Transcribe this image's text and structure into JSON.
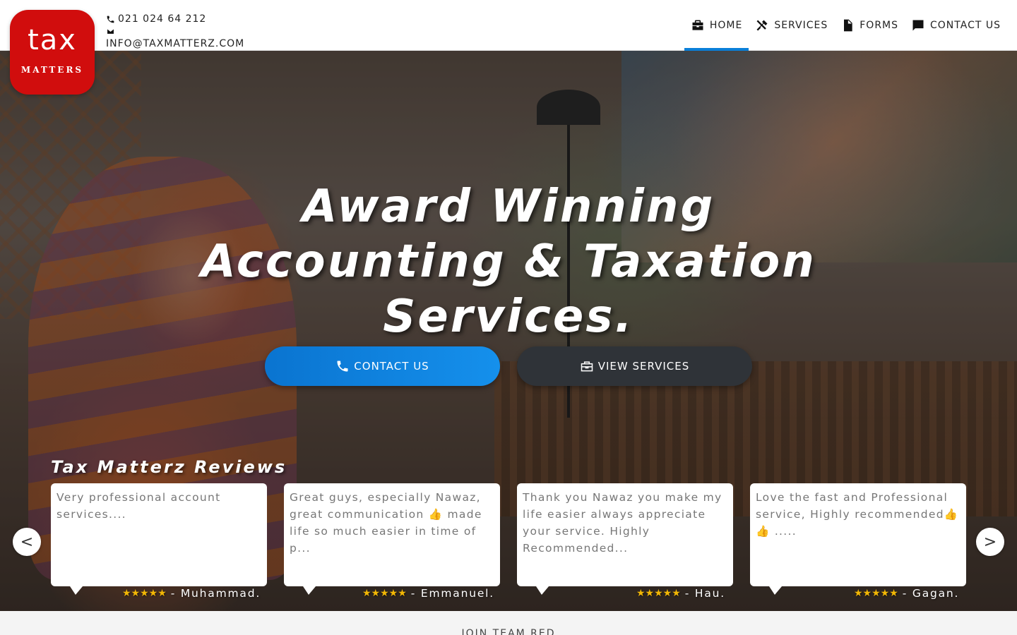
{
  "brand": {
    "logo_word": "tax",
    "logo_sub": "MATTERS"
  },
  "contact": {
    "phone": "021 024 64 212",
    "email": "INFO@TAXMATTERZ.COM"
  },
  "nav": [
    {
      "label": "HOME",
      "icon": "briefcase-icon",
      "active": true
    },
    {
      "label": "SERVICES",
      "icon": "tools-icon",
      "active": false
    },
    {
      "label": "FORMS",
      "icon": "document-icon",
      "active": false
    },
    {
      "label": "CONTACT US",
      "icon": "chat-icon",
      "active": false
    }
  ],
  "hero": {
    "title_line1": "Award Winning",
    "title_line2": "Accounting & Taxation",
    "title_line3": "Services.",
    "contact_button": "CONTACT US",
    "services_button": "VIEW SERVICES"
  },
  "reviews": {
    "title": "Tax Matterz Reviews",
    "items": [
      {
        "text": "Very professional account services....",
        "author": "- Muhammad.",
        "stars": "★★★★★"
      },
      {
        "text": "Great guys, especially Nawaz, great communication 👍 made life so much easier in time of p...",
        "author": "- Emmanuel.",
        "stars": "★★★★★"
      },
      {
        "text": "Thank you Nawaz you make my life easier always appreciate your service. Highly Recommended...",
        "author": "- Hau.",
        "stars": "★★★★★"
      },
      {
        "text": "Love the fast and Professional service, Highly recommended👍👍 .....",
        "author": "- Gagan.",
        "stars": "★★★★★"
      }
    ],
    "prev_label": "<",
    "next_label": ">"
  },
  "footer": {
    "join": "JOIN TEAM RED"
  },
  "colors": {
    "brand_red": "#d10d0d",
    "accent_blue": "#0a7fd8",
    "dark_button": "#2f3338",
    "star": "#f2b705"
  }
}
